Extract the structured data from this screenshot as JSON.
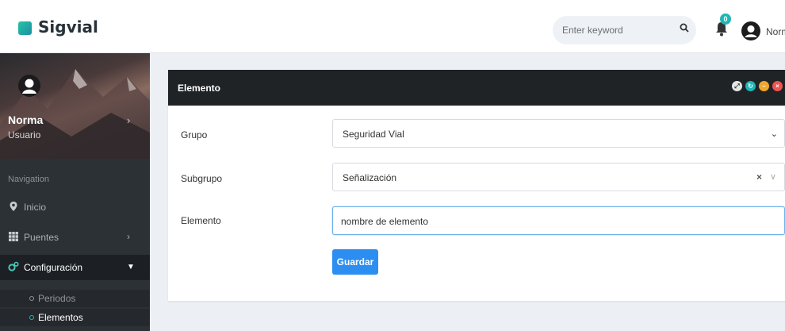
{
  "app": {
    "brand": "Sigvial"
  },
  "header": {
    "search_placeholder": "Enter keyword",
    "notification_count": "0",
    "user_name": "Norma"
  },
  "sidebar": {
    "profile": {
      "name": "Norma",
      "role": "Usuario"
    },
    "nav_title": "Navigation",
    "items": [
      {
        "label": "Inicio",
        "icon": "map-marker-icon"
      },
      {
        "label": "Puentes",
        "icon": "grid-icon"
      },
      {
        "label": "Configuración",
        "icon": "gears-icon"
      }
    ],
    "subitems": [
      {
        "label": "Periodos"
      },
      {
        "label": "Elementos"
      }
    ]
  },
  "card": {
    "title": "Elemento",
    "tool_icons": [
      "expand-icon",
      "refresh-icon",
      "minimize-icon",
      "close-icon"
    ],
    "fields": {
      "grupo": {
        "label": "Grupo",
        "value": "Seguridad Vial"
      },
      "subgrupo": {
        "label": "Subgrupo",
        "value": "Señalización"
      },
      "elemento": {
        "label": "Elemento",
        "value": "nombre de elemento"
      }
    },
    "save_label": "Guardar"
  },
  "colors": {
    "accent": "#2c8ef0",
    "sidebar_bg": "#2c3136",
    "card_header": "#202326",
    "badge": "#1fb6b6"
  }
}
